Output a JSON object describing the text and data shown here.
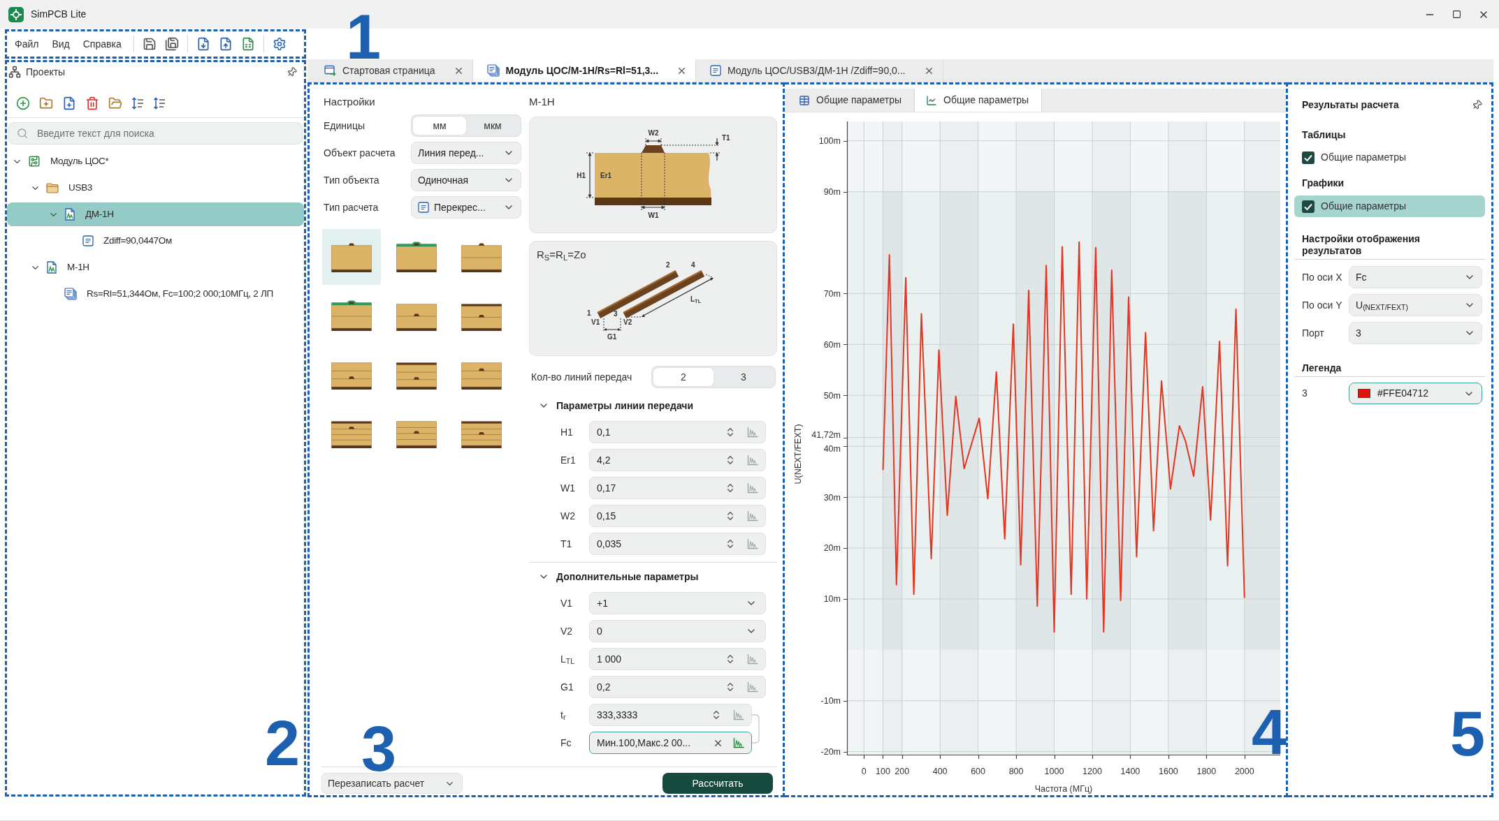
{
  "window": {
    "title": "SimPCB Lite"
  },
  "menu": {
    "callout": "1",
    "items": [
      "Файл",
      "Вид",
      "Справка"
    ]
  },
  "projects": {
    "callout": "2",
    "title": "Проекты",
    "search": {
      "placeholder": "Введите текст для поиска"
    },
    "tree": [
      {
        "label": "Модуль ЦОС*",
        "kind": "module",
        "expanded": true,
        "selected": false,
        "children": [
          {
            "label": "USB3",
            "kind": "folder",
            "expanded": true,
            "selected": false,
            "children": [
              {
                "label": "ДМ-1Н",
                "kind": "line",
                "expanded": true,
                "selected": true,
                "children": [
                  {
                    "label": "Zdiff=90,0447Ом",
                    "kind": "uf",
                    "selected": false
                  }
                ]
              }
            ]
          },
          {
            "label": "М-1Н",
            "kind": "line",
            "expanded": true,
            "selected": false,
            "children": [
              {
                "label": "Rs=Rl=51,344Ом, Fc=100;2 000;10МГц, 2 ЛП",
                "kind": "ct",
                "selected": false
              }
            ]
          }
        ]
      }
    ]
  },
  "tabs": [
    {
      "label": "Стартовая страница",
      "kind": "start",
      "selected": false
    },
    {
      "label": "Модуль ЦОС/М-1Н/Rs=Rl=51,3...",
      "kind": "ct",
      "selected": true
    },
    {
      "label": "Модуль ЦОС/USB3/ДМ-1Н /Zdiff=90,0...",
      "kind": "uf",
      "selected": false
    }
  ],
  "settings": {
    "callout": "3",
    "title": "Настройки",
    "units": {
      "label": "Единицы",
      "options": [
        {
          "label": "мм",
          "selected": true
        },
        {
          "label": "мкм",
          "selected": false
        }
      ]
    },
    "fields": [
      {
        "label": "Объект расчета",
        "value": "Линия перед...",
        "kind": "select"
      },
      {
        "label": "Тип объекта",
        "value": "Одиночная",
        "kind": "select"
      },
      {
        "label": "Тип расчета",
        "value": "Перекрес...",
        "kind": "tagged"
      }
    ],
    "structures": [
      {
        "kind": "microstrip",
        "selected": true
      },
      {
        "kind": "coated-microstrip",
        "selected": false
      },
      {
        "kind": "two-layer-microstrip",
        "selected": false
      },
      {
        "kind": "coated-two-layer-microstrip",
        "selected": false
      },
      {
        "kind": "embedded-microstrip",
        "selected": false
      },
      {
        "kind": "stripline",
        "selected": false
      },
      {
        "kind": "three-layer-embedded",
        "selected": false
      },
      {
        "kind": "three-layer-stripline",
        "selected": false
      },
      {
        "kind": "three-layer-upper",
        "selected": false
      },
      {
        "kind": "four-layer-stripline",
        "selected": false
      },
      {
        "kind": "four-layer-embedded",
        "selected": false
      },
      {
        "kind": "four-layer-lower-stripline",
        "selected": false
      }
    ],
    "model": {
      "title": "М-1Н",
      "cross_section": {
        "w2": "W2",
        "t1": "T1",
        "h1": "H1",
        "er1": "Er1",
        "w1": "W1"
      },
      "coupling": {
        "caption": "R$_{S}$=R$_{L}$=Zo",
        "labels": {
          "end2": "2",
          "end4": "4",
          "end1": "1",
          "end3": "3",
          "v1": "V1",
          "v2": "V2",
          "g1": "G1",
          "length": "L$_{TL}$"
        }
      }
    },
    "line_count": {
      "label": "Кол-во линий передач",
      "options": [
        {
          "label": "2",
          "selected": true
        },
        {
          "label": "3",
          "selected": false
        }
      ]
    },
    "sections": [
      {
        "title": "Параметры линии передачи",
        "expanded": true,
        "params": [
          {
            "label": "H1",
            "value": "0,1",
            "kind": "spin",
            "linked": false
          },
          {
            "label": "Er1",
            "value": "4,2",
            "kind": "spin",
            "linked": false
          },
          {
            "label": "W1",
            "value": "0,17",
            "kind": "spin",
            "linked": false
          },
          {
            "label": "W2",
            "value": "0,15",
            "kind": "spin",
            "linked": false
          },
          {
            "label": "T1",
            "value": "0,035",
            "kind": "spin",
            "linked": false
          }
        ]
      },
      {
        "title": "Дополнительные параметры",
        "expanded": true,
        "params": [
          {
            "label": "V1",
            "value": "+1",
            "kind": "select",
            "linked": false
          },
          {
            "label": "V2",
            "value": "0",
            "kind": "select",
            "linked": false
          },
          {
            "label": "L$_{TL}$",
            "value": "1 000",
            "kind": "spin",
            "linked": false
          },
          {
            "label": "G1",
            "value": "0,2",
            "kind": "spin",
            "linked": false
          },
          {
            "label": "t$_{r}$",
            "value": "333,3333",
            "kind": "spin",
            "linked": true
          },
          {
            "label": "Fc",
            "value": "Мин.100,Макс.2 00...",
            "kind": "sweep",
            "linked": true
          }
        ]
      }
    ],
    "overwrite": {
      "label": "Перезаписать расчет"
    },
    "calculate": {
      "label": "Рассчитать"
    }
  },
  "results_view": {
    "callout": "4",
    "tabs": [
      {
        "label": "Общие параметры",
        "kind": "table",
        "selected": false
      },
      {
        "label": "Общие параметры",
        "kind": "chart",
        "selected": true
      }
    ],
    "chart_data": {
      "type": "line",
      "xlabel": "Частота (МГц)",
      "ylabel": "U(NEXT/FEXT)",
      "x": [
        100,
        134,
        171,
        220,
        262,
        302,
        354,
        394,
        438,
        483,
        527,
        606,
        651,
        696,
        740,
        785,
        824,
        866,
        911,
        958,
        1000,
        1042,
        1089,
        1131,
        1171,
        1218,
        1260,
        1302,
        1349,
        1391,
        1433,
        1480,
        1522,
        1564,
        1611,
        1658,
        1690,
        1733,
        1780,
        1822,
        1869,
        1911,
        1955,
        2000
      ],
      "series": [
        {
          "color": "#e5341f",
          "values": [
            35.3,
            77.6,
            12.8,
            73.1,
            10.9,
            66.0,
            17.9,
            58.9,
            26.4,
            49.8,
            35.6,
            45.5,
            29.7,
            54.6,
            21.8,
            64.0,
            16.7,
            70.6,
            8.6,
            75.5,
            3.5,
            79.2,
            10.9,
            80.1,
            10.0,
            79.0,
            3.5,
            74.6,
            9.7,
            69.3,
            18.3,
            62.3,
            23.4,
            52.8,
            31.6,
            44.0,
            41.0,
            34.1,
            51.7,
            25.5,
            60.6,
            16.5,
            66.9,
            10.2
          ]
        }
      ],
      "xlim": [
        -89,
        2188
      ],
      "ylim": [
        -20.6,
        103.8
      ],
      "xticks": [
        0,
        100,
        200,
        400,
        600,
        800,
        1000,
        1200,
        1400,
        1600,
        1800,
        2000
      ],
      "yticks": [
        {
          "value": 100,
          "label": "100m"
        },
        {
          "value": 90,
          "label": "90m"
        },
        {
          "value": 70,
          "label": "70m"
        },
        {
          "value": 60,
          "label": "60m"
        },
        {
          "value": 50,
          "label": "50m"
        },
        {
          "value": 41.72,
          "label": "41,72m"
        },
        {
          "value": 40,
          "label": "40m"
        },
        {
          "value": 30,
          "label": "30m"
        },
        {
          "value": 20,
          "label": "20m"
        },
        {
          "value": 10,
          "label": "10m"
        },
        {
          "value": -10,
          "label": "-10m"
        },
        {
          "value": -20,
          "label": "-20m"
        }
      ],
      "grid": true
    }
  },
  "results": {
    "callout": "5",
    "title": "Результаты расчета",
    "groups": [
      {
        "title": "Таблицы",
        "items": [
          {
            "label": "Общие параметры",
            "checked": true,
            "selected": false
          }
        ]
      },
      {
        "title": "Графики",
        "items": [
          {
            "label": "Общие параметры",
            "checked": true,
            "selected": true
          }
        ]
      }
    ],
    "display": {
      "title": "Настройки отображения результатов",
      "fields": [
        {
          "label": "По оси X",
          "value": "Fc"
        },
        {
          "label": "По оси Y",
          "value": "U$_{(NEXT/FEXT)}$"
        },
        {
          "label": "Порт",
          "value": "3"
        }
      ]
    },
    "legend": {
      "title": "Легенда",
      "items": [
        {
          "label": "3",
          "value": "#FFE04712",
          "color": "#e3120b",
          "focused": true
        }
      ]
    }
  }
}
